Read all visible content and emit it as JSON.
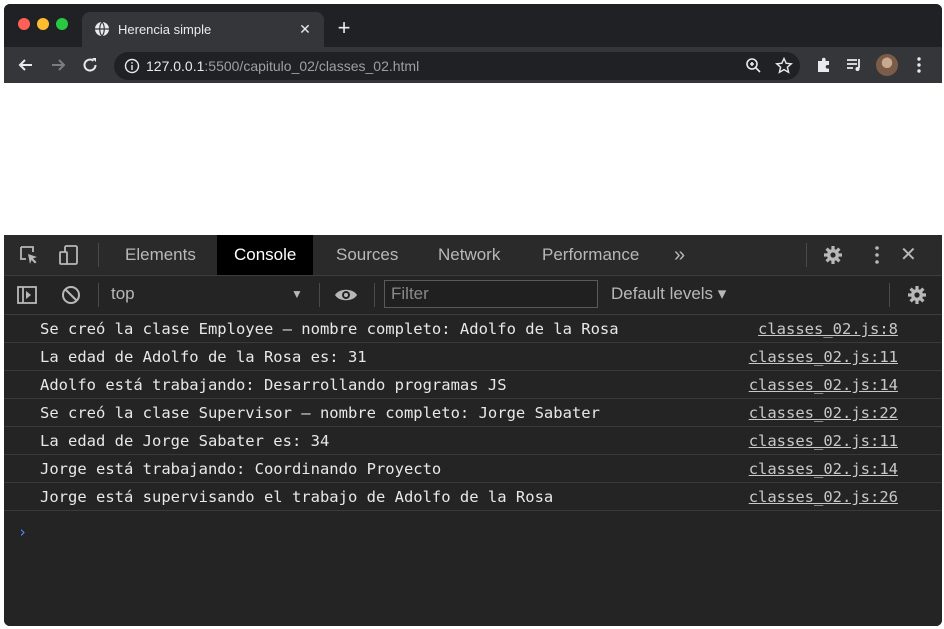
{
  "browser": {
    "tab_title": "Herencia simple",
    "tab_close_icon": "close-icon",
    "new_tab_label": "+",
    "url_host": "127.0.0.1",
    "url_rest": ":5500/capitulo_02/classes_02.html"
  },
  "devtools": {
    "tabs": [
      "Elements",
      "Console",
      "Sources",
      "Network",
      "Performance"
    ],
    "active_tab": "Console",
    "more_tabs_label": "»",
    "close_label": "✕"
  },
  "console": {
    "context": "top",
    "filter_placeholder": "Filter",
    "levels": "Default levels ▾",
    "prompt": "›",
    "messages": [
      {
        "text": "Se creó la clase Employee – nombre completo: Adolfo de la Rosa",
        "source": "classes_02.js:8"
      },
      {
        "text": "La edad de Adolfo de la Rosa es: 31",
        "source": "classes_02.js:11"
      },
      {
        "text": "Adolfo está trabajando: Desarrollando programas JS",
        "source": "classes_02.js:14"
      },
      {
        "text": "Se creó la clase Supervisor – nombre completo: Jorge Sabater",
        "source": "classes_02.js:22"
      },
      {
        "text": "La edad de Jorge Sabater es: 34",
        "source": "classes_02.js:11"
      },
      {
        "text": "Jorge está trabajando: Coordinando Proyecto",
        "source": "classes_02.js:14"
      },
      {
        "text": "Jorge está supervisando el trabajo de Adolfo de la Rosa",
        "source": "classes_02.js:26"
      }
    ]
  }
}
